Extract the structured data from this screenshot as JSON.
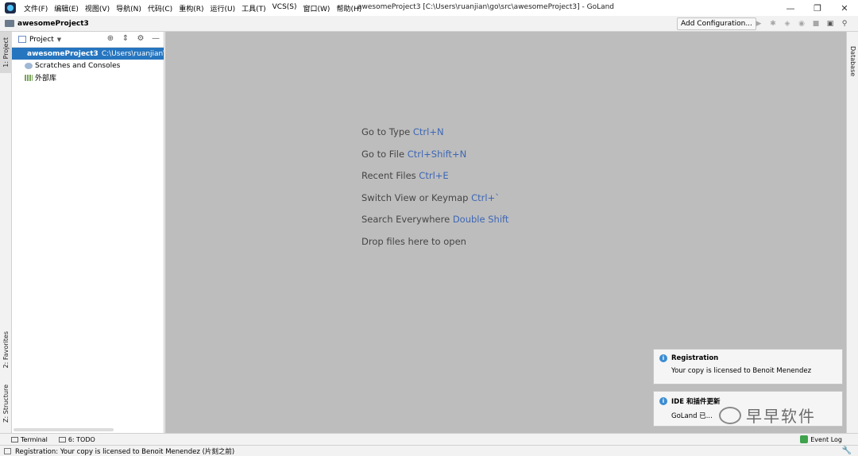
{
  "menu": [
    "文件(F)",
    "编辑(E)",
    "视图(V)",
    "导航(N)",
    "代码(C)",
    "重构(R)",
    "运行(U)",
    "工具(T)",
    "VCS(S)",
    "窗口(W)",
    "帮助(H)"
  ],
  "window_title": "awesomeProject3 [C:\\Users\\ruanjian\\go\\src\\awesomeProject3] - GoLand",
  "window_controls": {
    "minimize": "—",
    "restore": "❐",
    "close": "✕"
  },
  "navbar": {
    "project": "awesomeProject3",
    "add_config": "Add Configuration..."
  },
  "left_tabs": {
    "project": "1: Project",
    "favorites": "2: Favorites",
    "structure": "Z: Structure"
  },
  "right_tabs": {
    "database": "Database"
  },
  "project_panel": {
    "title": "Project",
    "tree": [
      {
        "label": "awesomeProject3",
        "path": "C:\\Users\\ruanjian\\go",
        "selected": true
      },
      {
        "label": "Scratches and Consoles"
      },
      {
        "label": "外部库"
      }
    ]
  },
  "hints": [
    {
      "text": "Go to Type",
      "key": "Ctrl+N"
    },
    {
      "text": "Go to File",
      "key": "Ctrl+Shift+N"
    },
    {
      "text": "Recent Files",
      "key": "Ctrl+E"
    },
    {
      "text": "Switch View or Keymap",
      "key": "Ctrl+`"
    },
    {
      "text": "Search Everywhere",
      "key": "Double Shift"
    },
    {
      "text": "Drop files here to open",
      "key": ""
    }
  ],
  "notifications": [
    {
      "title": "Registration",
      "body": "Your copy is licensed to Benoit Menendez"
    },
    {
      "title": "IDE 和插件更新",
      "body": "GoLand 已..."
    }
  ],
  "watermark": "早早软件",
  "bottom_tabs": {
    "terminal": "Terminal",
    "todo": "6: TODO",
    "event_log": "Event Log"
  },
  "status": "Registration: Your copy is licensed to Benoit Menendez (片刻之前)",
  "colors": {
    "selection": "#2675bf",
    "editor_bg": "#bdbdbd",
    "hint_key": "#3d67b5",
    "info": "#3b8dd3"
  }
}
